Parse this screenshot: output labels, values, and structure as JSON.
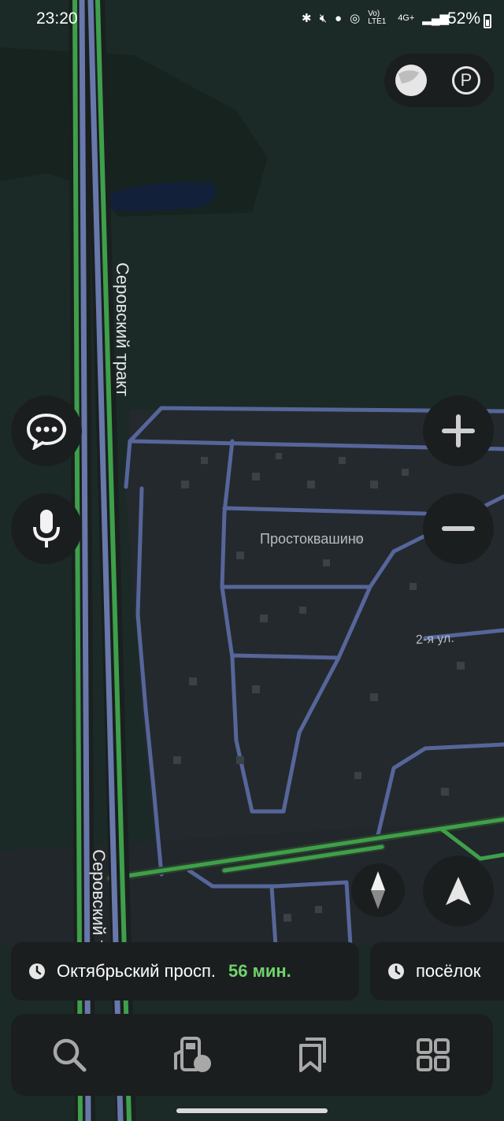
{
  "status_bar": {
    "time": "23:20",
    "network_text": "Vo) LTE1",
    "data_text": "4G+",
    "battery_percent": "52%"
  },
  "map": {
    "labels": {
      "road_top": "Серовский тракт",
      "road_bottom": "Серовский тракт",
      "village": "Простоквашино",
      "street": "2-я ул."
    }
  },
  "controls": {
    "layers_icon": "layers-icon",
    "parking_label": "P",
    "chat_icon": "chat-icon",
    "mic_icon": "microphone-icon",
    "zoom_in_icon": "plus-icon",
    "zoom_out_icon": "minus-icon",
    "compass_icon": "compass-icon",
    "locate_icon": "navigation-arrow-icon"
  },
  "routes": [
    {
      "destination": "Октябрьский просп.",
      "eta": "56 мин."
    },
    {
      "destination": "посёлок",
      "eta": ""
    }
  ],
  "bottom_nav": {
    "items": [
      {
        "icon": "search-icon"
      },
      {
        "icon": "gas-station-icon"
      },
      {
        "icon": "bookmarks-icon"
      },
      {
        "icon": "services-grid-icon"
      }
    ]
  },
  "colors": {
    "background": "#1c2a27",
    "road": "#5a6a9a",
    "traffic_green": "#3ea04a",
    "accent_eta": "#6fd36c",
    "panel": "#1b1e1f"
  }
}
